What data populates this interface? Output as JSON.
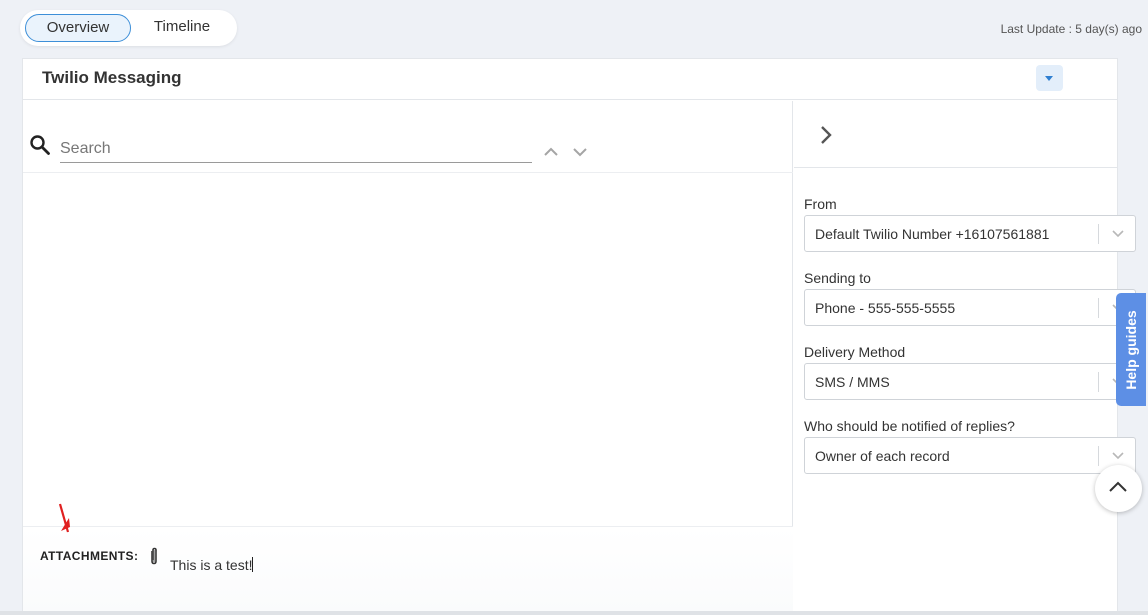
{
  "header": {
    "tabs": [
      {
        "label": "Overview",
        "active": true
      },
      {
        "label": "Timeline",
        "active": false
      }
    ],
    "last_update": "Last Update : 5 day(s) ago"
  },
  "panel": {
    "title": "Twilio Messaging",
    "collapse_icon": "caret-down-icon"
  },
  "search": {
    "placeholder": "Search",
    "value": "",
    "icon": "search-icon"
  },
  "compose": {
    "attachments_label": "ATTACHMENTS:",
    "message_text": "This is a test!"
  },
  "sidebar": {
    "fields": [
      {
        "label": "From",
        "value": "Default Twilio Number +16107561881"
      },
      {
        "label": "Sending to",
        "value": "Phone - 555-555-5555"
      },
      {
        "label": "Delivery Method",
        "value": "SMS / MMS"
      },
      {
        "label": "Who should be notified of replies?",
        "value": "Owner of each record"
      }
    ]
  },
  "help_tab": {
    "label": "Help guides"
  },
  "colors": {
    "accent": "#3d8fd8",
    "help_tab": "#5d8fe5",
    "annotation_arrow": "#e02020",
    "background": "#eef1f6"
  }
}
